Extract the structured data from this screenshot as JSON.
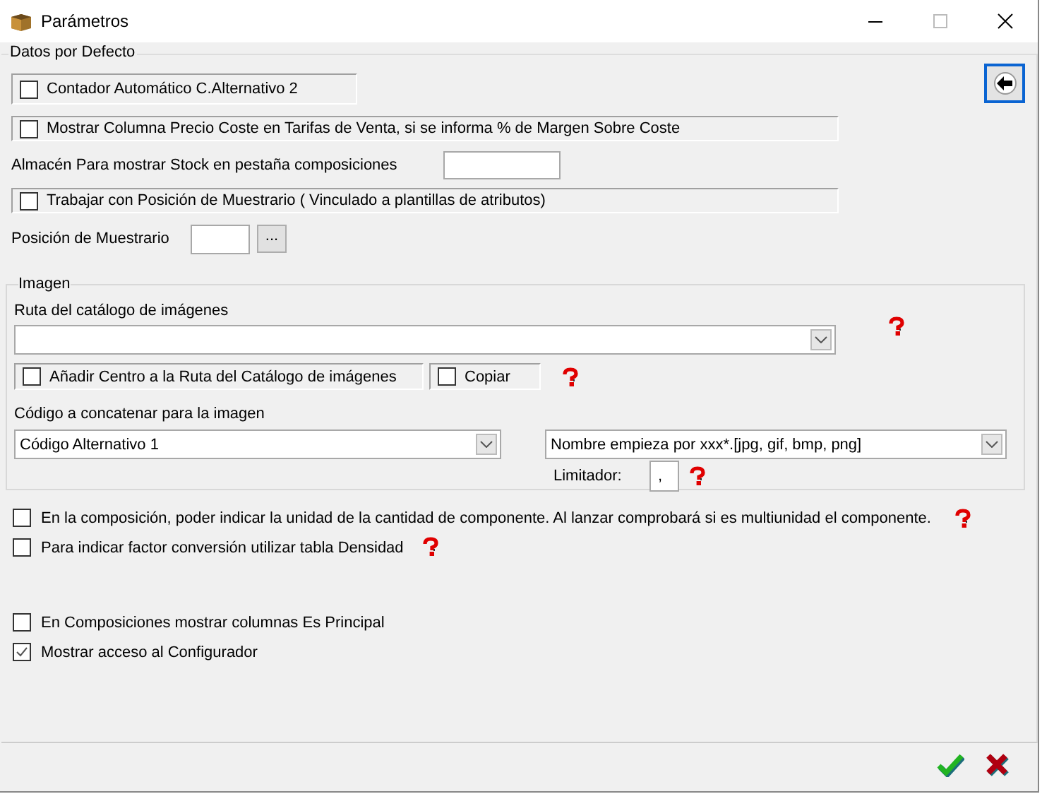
{
  "window": {
    "title": "Parámetros"
  },
  "defaults": {
    "title": "Datos por Defecto",
    "counter_check": {
      "label": "Contador Automático C.Alternativo 2",
      "checked": false
    },
    "cost_column_check": {
      "label": "Mostrar Columna Precio Coste en Tarifas de Venta, si se informa % de Margen Sobre Coste",
      "checked": false
    },
    "stock_warehouse": {
      "label": "Almacén Para mostrar Stock en pestaña composiciones"
    },
    "sample_position_check": {
      "label": "Trabajar con Posición de Muestrario ( Vinculado a plantillas de atributos)",
      "checked": false
    },
    "sample_position": {
      "label": "Posición de Muestrario",
      "browse": "..."
    }
  },
  "image": {
    "title": "Imagen",
    "catalog_path_label": "Ruta del catálogo de imágenes",
    "add_center_check": {
      "label": "Añadir Centro a la Ruta del Catálogo de imágenes",
      "checked": false
    },
    "copy_check": {
      "label": "Copiar",
      "checked": false
    },
    "code_label": "Código a concatenar para la imagen",
    "code_select": "Código Alternativo 1",
    "name_select": "Nombre empieza por xxx*.[jpg, gif, bmp, png]",
    "delimiter_label": "Limitador:",
    "delimiter": ","
  },
  "options": [
    {
      "label": "En la composición, poder indicar la unidad de la cantidad de componente. Al lanzar comprobará si es multiunidad el componente.",
      "checked": false,
      "help": true
    },
    {
      "label": "Para indicar factor conversión utilizar tabla Densidad",
      "checked": false,
      "help": true
    }
  ],
  "extra_options": [
    {
      "label": "En Composiciones mostrar columnas Es Principal",
      "checked": false
    },
    {
      "label": "Mostrar acceso al Configurador",
      "checked": true
    }
  ]
}
